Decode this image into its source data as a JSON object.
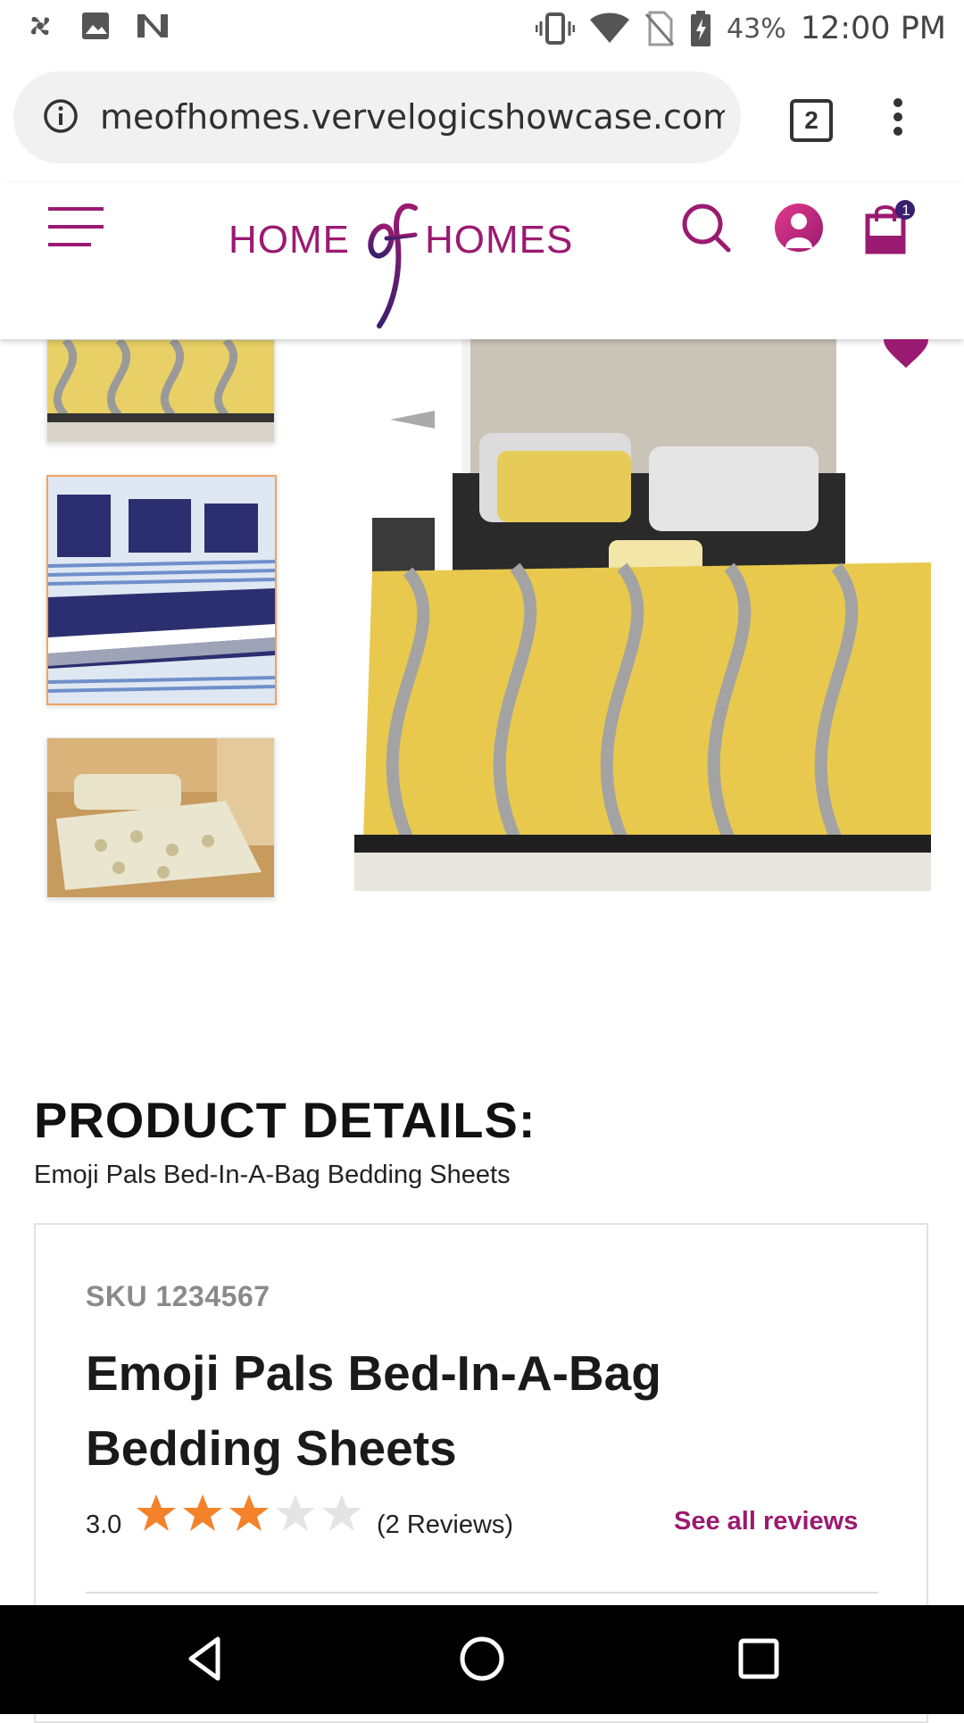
{
  "status_bar": {
    "battery_pct": "43%",
    "time": "12:00 PM"
  },
  "browser": {
    "url": "meofhomes.vervelogicshowcase.com",
    "tab_count": "2"
  },
  "header": {
    "logo_left": "HOME",
    "logo_mid": "of",
    "logo_right": "HOMES",
    "cart_count": "1",
    "brand_color": "#9b1a71"
  },
  "gallery": {
    "thumbnails": [
      {
        "name": "yellow-gray-damask-bedding"
      },
      {
        "name": "navy-striped-bedding",
        "selected": true
      },
      {
        "name": "beige-floral-bedspread"
      }
    ],
    "main_image": "yellow-gray-damask-bedding"
  },
  "product": {
    "section_heading": "PRODUCT DETAILS:",
    "section_subtitle": "Emoji Pals Bed-In-A-Bag Bedding Sheets",
    "sku": "SKU 1234567",
    "title": "Emoji Pals Bed-In-A-Bag Bedding Sheets",
    "rating_value": "3.0",
    "rating": 3,
    "rating_max": 5,
    "review_count": "(2 Reviews)",
    "see_all_reviews": "See all reviews",
    "star_color": "#f4822a"
  }
}
